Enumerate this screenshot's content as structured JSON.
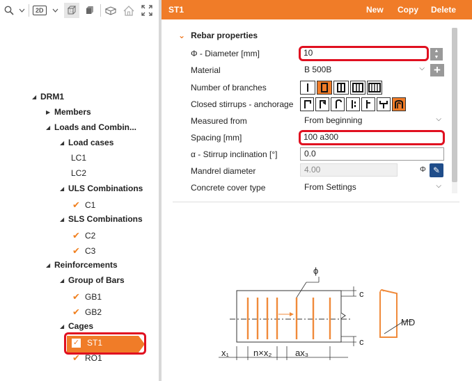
{
  "toolbar": {
    "view_mode": "2D"
  },
  "tree": {
    "root": "DRM1",
    "members": "Members",
    "loads": "Loads and Combin...",
    "load_cases": "Load cases",
    "lc1": "LC1",
    "lc2": "LC2",
    "uls": "ULS Combinations",
    "c1": "C1",
    "sls": "SLS Combinations",
    "c2": "C2",
    "c3": "C3",
    "reinforcements": "Reinforcements",
    "group_of_bars": "Group of Bars",
    "gb1": "GB1",
    "gb2": "GB2",
    "cages": "Cages",
    "st1": "ST1",
    "ro1": "RO1"
  },
  "header": {
    "title": "ST1",
    "new_label": "New",
    "copy_label": "Copy",
    "delete_label": "Delete"
  },
  "properties": {
    "section_title": "Rebar properties",
    "diameter_label": "Φ - Diameter [mm]",
    "diameter_value": "10",
    "material_label": "Material",
    "material_value": "B 500B",
    "branches_label": "Number of branches",
    "stirrups_label": "Closed stirrups - anchorage",
    "measured_label": "Measured from",
    "measured_value": "From beginning",
    "spacing_label": "Spacing [mm]",
    "spacing_value": "100 a300",
    "inclination_label": "α - Stirrup inclination [°]",
    "inclination_value": "0.0",
    "mandrel_label": "Mandrel diameter",
    "mandrel_value": "4.00",
    "mandrel_unit": "Φ",
    "cover_label": "Concrete cover type",
    "cover_value": "From Settings"
  },
  "diagram": {
    "phi": "ϕ",
    "c_top": "c",
    "c_bottom": "c",
    "md": "MD",
    "x1": "x₁",
    "nx2": "n×x₂",
    "ax3": "ax₃"
  },
  "colors": {
    "accent": "#f07c28",
    "highlight": "#e01020"
  }
}
